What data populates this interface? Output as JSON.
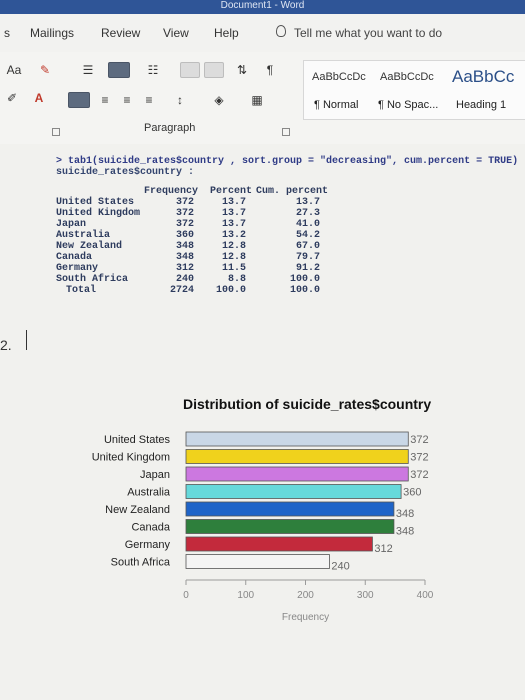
{
  "window": {
    "title": "Document1 - Word"
  },
  "tabs": [
    "s",
    "Mailings",
    "Review",
    "View",
    "Help"
  ],
  "tell_me": "Tell me what you want to do",
  "ribbon": {
    "font_box": "Aa",
    "styles": [
      {
        "sample": "AaBbCcDc",
        "name": "¶ Normal"
      },
      {
        "sample": "AaBbCcDc",
        "name": "¶ No Spac..."
      },
      {
        "sample": "AaBbCc",
        "name": "Heading 1"
      }
    ],
    "group_label": "Paragraph"
  },
  "console": {
    "command": "> tab1(suicide_rates$country , sort.group = \"decreasing\", cum.percent = TRUE)",
    "header_line": "suicide_rates$country :",
    "columns": [
      "Frequency",
      "Percent",
      "Cum. percent"
    ],
    "rows": [
      {
        "label": "United States",
        "freq": "372",
        "pct": "13.7",
        "cum": "13.7"
      },
      {
        "label": "United Kingdom",
        "freq": "372",
        "pct": "13.7",
        "cum": "27.3"
      },
      {
        "label": "Japan",
        "freq": "372",
        "pct": "13.7",
        "cum": "41.0"
      },
      {
        "label": "Australia",
        "freq": "360",
        "pct": "13.2",
        "cum": "54.2"
      },
      {
        "label": "New Zealand",
        "freq": "348",
        "pct": "12.8",
        "cum": "67.0"
      },
      {
        "label": "Canada",
        "freq": "348",
        "pct": "12.8",
        "cum": "79.7"
      },
      {
        "label": "Germany",
        "freq": "312",
        "pct": "11.5",
        "cum": "91.2"
      },
      {
        "label": "South Africa",
        "freq": "240",
        "pct": "8.8",
        "cum": "100.0"
      },
      {
        "label": "Total",
        "freq": "2724",
        "pct": "100.0",
        "cum": "100.0"
      }
    ]
  },
  "list_marker": "2.",
  "chart_data": {
    "type": "bar",
    "orientation": "horizontal",
    "title": "Distribution of suicide_rates$country",
    "xlabel": "Frequency",
    "ylabel": "",
    "categories": [
      "United States",
      "United Kingdom",
      "Japan",
      "Australia",
      "New Zealand",
      "Canada",
      "Germany",
      "South Africa"
    ],
    "values": [
      372,
      372,
      372,
      360,
      348,
      348,
      312,
      240
    ],
    "bar_colors": [
      "#c9d7e6",
      "#f0d21c",
      "#cc78e0",
      "#66d9db",
      "#1f64c8",
      "#2e7f3c",
      "#c32a3c",
      "#f4f4f4"
    ],
    "xlim": [
      0,
      400
    ],
    "xticks": [
      0,
      100,
      200,
      300,
      400
    ],
    "grid": false,
    "legend": "none"
  }
}
